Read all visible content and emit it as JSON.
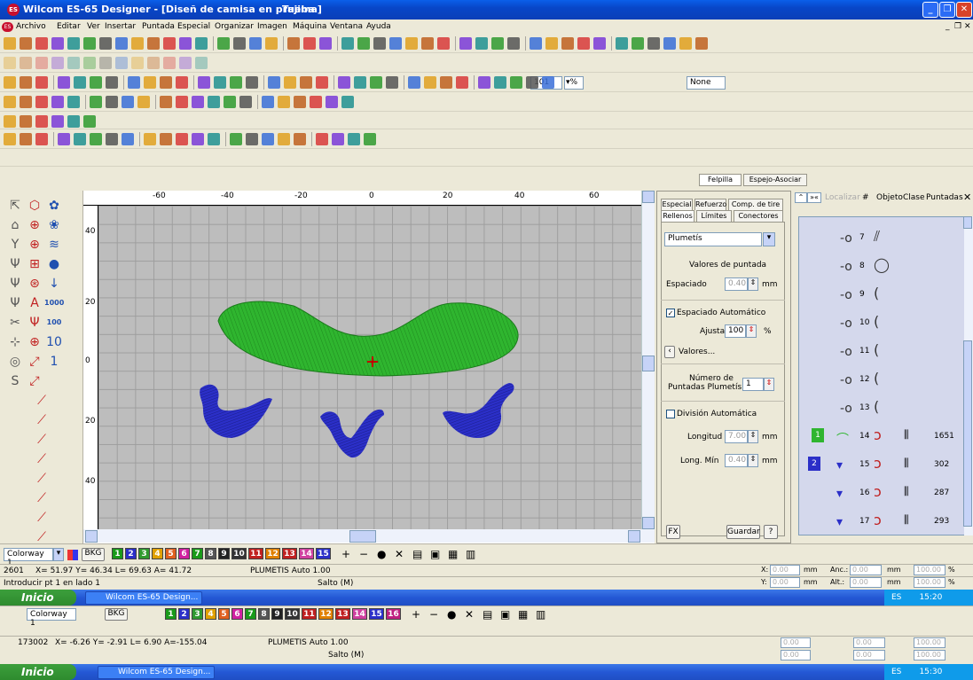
{
  "window": {
    "title": "Wilcom ES-65 Designer - [Diseñ de camisa  en prueba",
    "title_machine": "Tajima]",
    "app_icon": "ES"
  },
  "menu": [
    "Archivo",
    "Editar",
    "Ver",
    "Insertar",
    "Puntada",
    "Especial",
    "Organizar",
    "Imagen",
    "Máquina",
    "Ventana",
    "Ayuda"
  ],
  "toolbar": {
    "zoom_value": "101",
    "zoom_unit": "%",
    "color_select": "None"
  },
  "rulers": {
    "h_labels": [
      "-60",
      "-40",
      "-20",
      "0",
      "20",
      "40",
      "60"
    ],
    "v_labels": [
      "40",
      "20",
      "0",
      "20",
      "40"
    ]
  },
  "panel_tabs_top": {
    "felpilla": "Felpilla",
    "espejo": "Espejo-Asociar"
  },
  "props": {
    "tabs_row1": [
      "Especial",
      "Refuerzo",
      "Comp. de tire"
    ],
    "tabs_row2": [
      "Rellenos",
      "Límites",
      "Conectores"
    ],
    "fill_type": "Plumetís",
    "heading": "Valores de puntada",
    "espaciado_label": "Espaciado",
    "espaciado_value": "0.40",
    "mm1": "mm",
    "auto_spacing_label": "Espaciado Automático",
    "ajustar_label": "Ajustar",
    "ajustar_value": "100",
    "pct": "%",
    "valores_btn": "Valores...",
    "num_label_1": "Número de",
    "num_label_2": "Puntadas Plumetís",
    "num_value": "1",
    "auto_div_label": "División Automática",
    "longitud_label": "Longitud",
    "longitud_value": "7.00",
    "mm2": "mm",
    "longmin_label": "Long. Mín",
    "longmin_value": "0.40",
    "mm3": "mm",
    "fx_btn": "FX",
    "guardar_btn": "Guardar",
    "help_btn": "?"
  },
  "objects": {
    "localizar": "Localizar",
    "col_hash": "#",
    "col_objeto": "Objeto",
    "col_clase": "Clase",
    "col_puntadas": "Puntadas",
    "rows": [
      {
        "num": "7",
        "count": ""
      },
      {
        "num": "8",
        "count": ""
      },
      {
        "num": "9",
        "count": ""
      },
      {
        "num": "10",
        "count": ""
      },
      {
        "num": "11",
        "count": ""
      },
      {
        "num": "12",
        "count": ""
      },
      {
        "num": "13",
        "count": ""
      },
      {
        "num": "14",
        "count": "1651",
        "color_idx": "1"
      },
      {
        "num": "15",
        "count": "302",
        "color_idx": "2"
      },
      {
        "num": "16",
        "count": "287"
      },
      {
        "num": "17",
        "count": "293"
      }
    ]
  },
  "colorbar": {
    "colorway": "Colorway 1",
    "bkg": "BKG",
    "swatches": [
      "1",
      "2",
      "3",
      "4",
      "5",
      "6",
      "7",
      "8",
      "9",
      "10",
      "11",
      "12",
      "13",
      "14",
      "15"
    ],
    "swatches2": [
      "1",
      "2",
      "3",
      "4",
      "5",
      "6",
      "7",
      "8",
      "9",
      "10",
      "11",
      "12",
      "13",
      "14",
      "15",
      "16"
    ],
    "colorway2": "Colorway 1"
  },
  "status1": {
    "count": "2601",
    "coords": "X= 51.97 Y= 46.34 L= 69.63 A= 41.72",
    "type": "PLUMETIS Auto 1.00",
    "hint": "Introducir pt 1 en lado 1",
    "jump": "Salto (M)",
    "x_val": "0.00",
    "y_val": "0.00",
    "anc_val": "0.00",
    "alt_val": "0.00",
    "pct1": "100.00",
    "pct2": "100.00",
    "x_lbl": "X:",
    "y_lbl": "Y:",
    "anc_lbl": "Anc.:",
    "alt_lbl": "Alt.:",
    "mm": "mm",
    "pct": "%"
  },
  "taskbar1": {
    "start": "Inicio",
    "task": "Wilcom ES-65 Design...",
    "lang": "ES",
    "time": "15:20"
  },
  "status2": {
    "count": "173002",
    "coords": "X= -6.26 Y= -2.91 L= 6.90 A=-155.04",
    "type": "PLUMETIS Auto 1.00",
    "jump": "Salto (M)",
    "x_val": "0.00",
    "y_val": "0.00",
    "anc_val": "0.00",
    "alt_val": "0.00",
    "pct1": "100.00",
    "pct2": "100.00"
  },
  "taskbar2": {
    "start": "Inicio",
    "task": "Wilcom ES-65 Design...",
    "lang": "ES",
    "time": "15:30"
  },
  "colors": {
    "green": "#2FB52F",
    "blue": "#2B2FC8",
    "grid": "#BDBDBD",
    "xp_blue": "#0A5FEA"
  }
}
